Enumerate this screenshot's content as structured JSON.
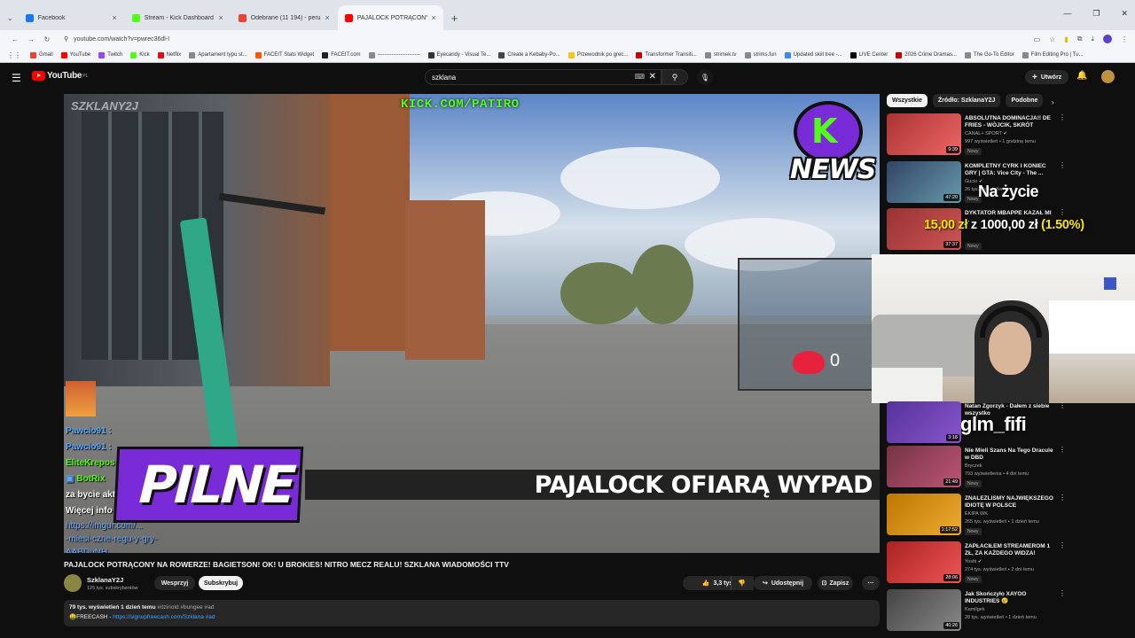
{
  "browser": {
    "tabs": [
      {
        "title": "Facebook",
        "color": "#1877f2"
      },
      {
        "title": "Stream - Kick Dashboard",
        "color": "#53fc18"
      },
      {
        "title": "Odebrane (11 194) - peruzyni...",
        "color": "#ea4335"
      },
      {
        "title": "PAJALOCK POTRĄCONY N...",
        "color": "#ff0000"
      }
    ],
    "url": "youtube.com/watch?v=pwrec36dl-I",
    "bookmarks": [
      {
        "label": "Gmail",
        "color": "#ea4335"
      },
      {
        "label": "YouTube",
        "color": "#ff0000"
      },
      {
        "label": "Twitch",
        "color": "#9146ff"
      },
      {
        "label": "Kick",
        "color": "#53fc18"
      },
      {
        "label": "Netflix",
        "color": "#e50914"
      },
      {
        "label": "Apartament typu st...",
        "color": "#888888"
      },
      {
        "label": "FACEIT Stats Widget",
        "color": "#ff5500"
      },
      {
        "label": "FACEIT.com",
        "color": "#222222"
      },
      {
        "label": "------------------------",
        "color": "#888888"
      },
      {
        "label": "Eyecandy - Visual Te...",
        "color": "#333333"
      },
      {
        "label": "Create a Kebaby-Po...",
        "color": "#444444"
      },
      {
        "label": "Przewodnik po grec...",
        "color": "#f5c518"
      },
      {
        "label": "Transformer Transiti...",
        "color": "#cc0000"
      },
      {
        "label": "strimek.tv",
        "color": "#888888"
      },
      {
        "label": "strims.fun",
        "color": "#888888"
      },
      {
        "label": "Updated skill tree -...",
        "color": "#4285f4"
      },
      {
        "label": "LIVE Center",
        "color": "#000000"
      },
      {
        "label": "2026 Crime Dramas...",
        "color": "#cc0000"
      },
      {
        "label": "The Go-To Editor",
        "color": "#888888"
      },
      {
        "label": "Film Editing Pro | Tu...",
        "color": "#888888"
      }
    ]
  },
  "youtube": {
    "logo": "YouTube",
    "region": "PL",
    "search_value": "szklana",
    "create_label": "Utwórz"
  },
  "player": {
    "kick_url": "KICK.COM/PATIRO",
    "watermark": "SZKLANY2J",
    "news_k": "K",
    "news_word": "NEWS",
    "heart_count": "0",
    "chat": [
      {
        "user": "Pawcio91",
        "sep": " :",
        "cls": "blue"
      },
      {
        "user": "Pawcio91",
        "sep": " :",
        "cls": "blue"
      },
      {
        "user": "EliteKrepos",
        "sep": "",
        "cls": "green"
      },
      {
        "user": "BotRix",
        "sep": "",
        "cls": "green"
      },
      {
        "user": "za bycie akty",
        "sep": "",
        "cls": "white"
      },
      {
        "user": "Więcej info",
        "sep": "",
        "cls": "white"
      }
    ],
    "chat_links": [
      "https://imgur.com/...",
      "-miesi-czne-regu-y-gry-",
      "AABDuNH"
    ],
    "pilne": "PILNE",
    "lower_third": "PAJALOCK OFIARĄ WYPAD"
  },
  "video": {
    "title": "PAJALOCK POTRĄCONY NA ROWERZE! BAGIETSON! OK! U BROKIES! NITRO MECZ REALU! SZKLANA WIADOMOŚCI TTV",
    "channel": "SzklanaY2J",
    "subscribers": "125 tys. subskrybentów",
    "join_label": "Wesprzyj",
    "subscribe_label": "Subskrybuj",
    "likes": "3,3 tys.",
    "share_label": "Udostępnij",
    "save_label": "Zapisz",
    "desc_stats": "79 tys. wyświetleń  1 dzień temu",
    "desc_tags": "#dzinold #bungee #ad",
    "desc_line2_prefix": "🤑FREECASH - ",
    "desc_link": "https://signupfreecash.com/Szklana #ad"
  },
  "sidebar": {
    "chips": [
      {
        "label": "Wszystkie",
        "active": true
      },
      {
        "label": "Źródło: SzklanaY2J",
        "active": false
      },
      {
        "label": "Podobne",
        "active": false
      }
    ],
    "recommendations": [
      {
        "title": "ABSOLUTNA DOMINACJA!! DE FRIES - WÓJCIK, SKRÓT WALK...",
        "channel": "CANAL+ SPORT ✔",
        "meta": "997 wyświetleń • 1 godzinę temu",
        "badge": "Nowy",
        "duration": "9:39",
        "color": "#a33"
      },
      {
        "title": "KOMPLETNY CYRK I KONIEC GRY | GTA: Vice City - The ...",
        "channel": "Gucio ✔",
        "meta": "26 tys. wyświetleń",
        "badge": "Nowy",
        "duration": "47:20",
        "color": "#346"
      },
      {
        "title": "DYKTATOR MBAPPE KAZAŁ MI ...",
        "channel": "",
        "meta": "",
        "badge": "Nowy",
        "duration": "37:37",
        "color": "#933"
      },
      {
        "title": "Natan Zgorzyk - Dałem z siebie wszystko",
        "channel": "",
        "meta": "",
        "badge": "",
        "duration": "3:18",
        "color": "#539"
      },
      {
        "title": "Nie Mieli Szans Na Tego Dracule w DBD",
        "channel": "Bryczek",
        "meta": "793 wyświetlenia • 4 dni temu",
        "badge": "Nowy",
        "duration": "21:49",
        "color": "#734"
      },
      {
        "title": "ZNALEŹLIŚMY NAJWIĘKSZEGO IDIOTĘ W POLSCE",
        "channel": "EKIPA WK",
        "meta": "265 tys. wyświetleń • 1 dzień temu",
        "badge": "Nowy",
        "duration": "1:17:52",
        "color": "#b70"
      },
      {
        "title": "ZAPŁACIŁEM STREAMEROM 1 ZŁ, ZA KAŻDEGO WIDZA!",
        "channel": "Yoshi ✔",
        "meta": "274 tys. wyświetleń • 2 dni temu",
        "badge": "Nowy",
        "duration": "28:06",
        "color": "#a22"
      },
      {
        "title": "Jak Skończyło XAYOO INDUSTRIES 😢",
        "channel": "Kamilgek",
        "meta": "28 tys. wyświetleń • 1 dzień temu",
        "badge": "",
        "duration": "40:26",
        "color": "#444"
      }
    ]
  },
  "overlays": {
    "na_zycie": "Na życie",
    "money_amount": "15,00 zł",
    "money_of": " z 1000,00 zł ",
    "money_pct": "(1.50%)",
    "glm": "glm_fifi"
  }
}
